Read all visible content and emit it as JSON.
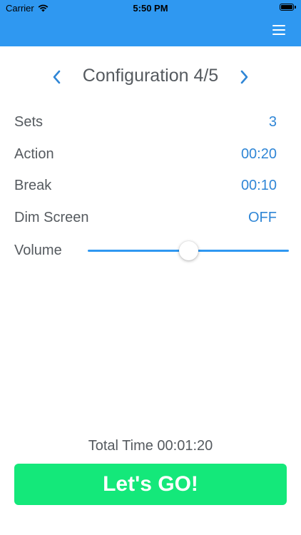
{
  "status_bar": {
    "carrier": "Carrier",
    "time": "5:50 PM"
  },
  "nav": {
    "menu_icon": "hamburger-menu-icon",
    "bar_color": "#2f98f1"
  },
  "configuration": {
    "title": "Configuration 4/5",
    "prev_icon": "chevron-left-icon",
    "next_icon": "chevron-right-icon"
  },
  "settings": [
    {
      "label": "Sets",
      "value": "3"
    },
    {
      "label": "Action",
      "value": "00:20"
    },
    {
      "label": "Break",
      "value": "00:10"
    },
    {
      "label": "Dim Screen",
      "value": "OFF"
    }
  ],
  "volume": {
    "label": "Volume",
    "level": 0.5
  },
  "total": {
    "text": "Total Time 00:01:20"
  },
  "go_button": {
    "label": "Let's GO!",
    "color": "#14e87a"
  },
  "colors": {
    "accent": "#2f98f1",
    "value_text": "#2f86d6",
    "label_text": "#555a5f"
  }
}
